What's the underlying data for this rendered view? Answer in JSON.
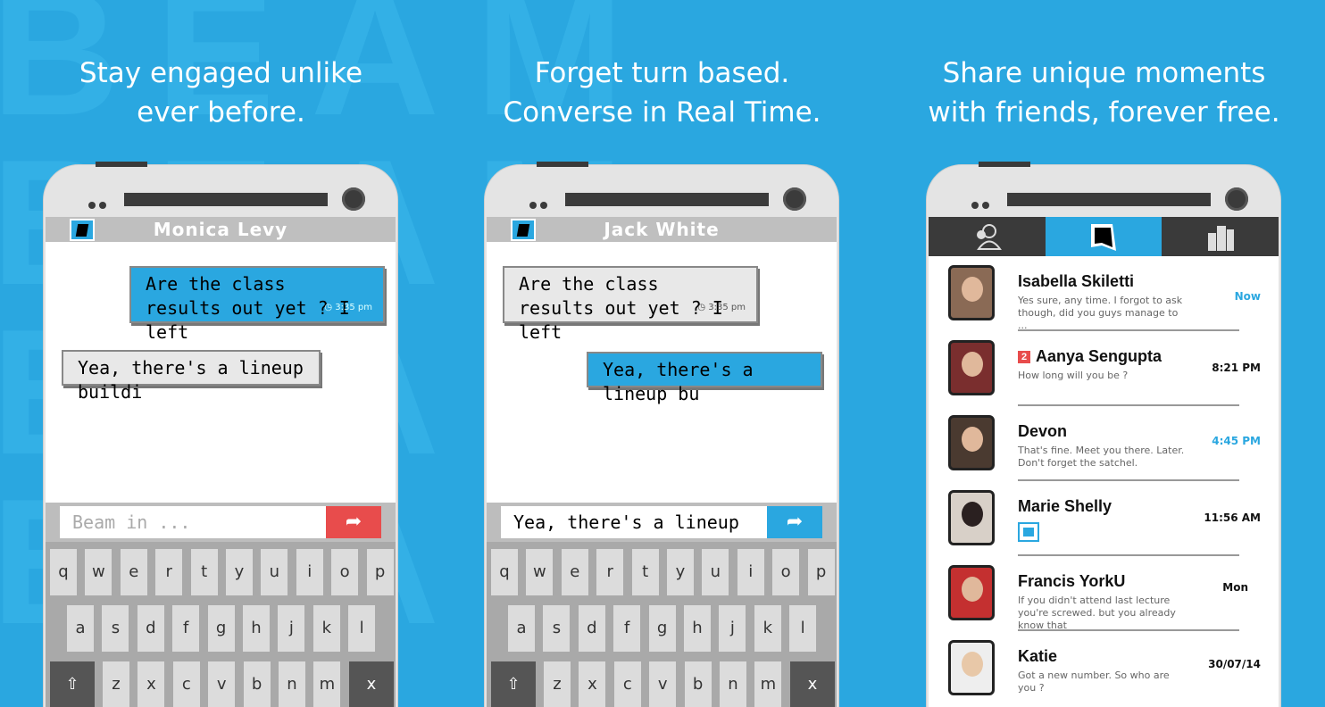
{
  "colors": {
    "background": "#2aa7e0",
    "accent": "#2aa7e0",
    "send_red": "#e84c4c",
    "dark": "#3a3a3a"
  },
  "background_word": "BEAM",
  "panels": [
    {
      "caption": [
        "Stay engaged unlike",
        "ever before."
      ],
      "contact": "Monica Levy",
      "messages": [
        {
          "text": "Are the class results out yet ? I left",
          "time": "3:35 pm",
          "style": "blue"
        },
        {
          "text": "Yea, there's a lineup buildi",
          "style": "gray"
        }
      ],
      "input_placeholder": "Beam in ...",
      "send_color": "#e84c4c"
    },
    {
      "caption": [
        "Forget turn based.",
        "Converse in Real Time."
      ],
      "contact": "Jack White",
      "messages": [
        {
          "text": "Are the class results out yet ? I left",
          "time": "3:35 pm",
          "style": "gray"
        },
        {
          "text": "Yea, there's a lineup bu",
          "style": "blue"
        }
      ],
      "input_value": "Yea, there's a lineup bu",
      "send_color": "#2aa7e0"
    },
    {
      "caption": [
        "Share unique moments",
        "with friends, forever free."
      ],
      "tabs": [
        "friends-icon",
        "beam-logo-icon",
        "buildings-icon"
      ],
      "conversations": [
        {
          "name": "Isabella Skiletti",
          "message": "Yes sure, any time. I forgot to ask though, did you guys manage to ...",
          "time": "Now",
          "time_blue": true
        },
        {
          "name": "Aanya Sengupta",
          "badge": "2",
          "message": "How long will you be ?",
          "time": "8:21 PM"
        },
        {
          "name": "Devon",
          "message": "That's fine. Meet you there. Later. Don't forget the satchel.",
          "time": "4:45 PM",
          "time_blue": true
        },
        {
          "name": "Marie Shelly",
          "message": "",
          "time": "11:56 AM",
          "image": true
        },
        {
          "name": "Francis YorkU",
          "message": "If you didn't attend last lecture you're screwed. but you already know that",
          "time": "Mon"
        },
        {
          "name": "Katie",
          "message": "Got a new number. So who are you ?",
          "time": "30/07/14"
        }
      ]
    }
  ],
  "keyboard": {
    "row1": [
      "q",
      "w",
      "e",
      "r",
      "t",
      "y",
      "u",
      "i",
      "o",
      "p"
    ],
    "row2": [
      "a",
      "s",
      "d",
      "f",
      "g",
      "h",
      "j",
      "k",
      "l"
    ],
    "row3": [
      "z",
      "x",
      "c",
      "v",
      "b",
      "n",
      "m"
    ],
    "shift": "⇧",
    "backspace": "x"
  }
}
